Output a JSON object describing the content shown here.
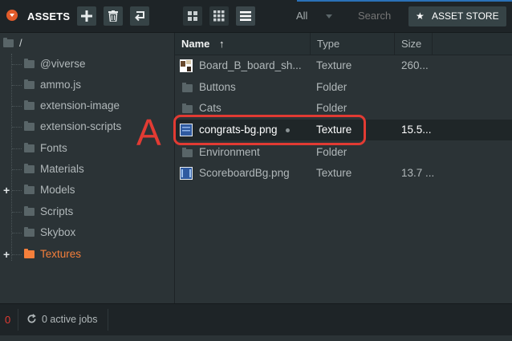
{
  "toolbar": {
    "title": "ASSETS",
    "add_label": "+",
    "filter_value": "All",
    "search_placeholder": "Search",
    "store_label": "ASSET STORE"
  },
  "tree": {
    "root_label": "/",
    "items": [
      {
        "label": "@viverse",
        "expandable": false,
        "active": false
      },
      {
        "label": "ammo.js",
        "expandable": false,
        "active": false
      },
      {
        "label": "extension-image",
        "expandable": false,
        "active": false
      },
      {
        "label": "extension-scripts",
        "expandable": false,
        "active": false
      },
      {
        "label": "Fonts",
        "expandable": false,
        "active": false
      },
      {
        "label": "Materials",
        "expandable": false,
        "active": false
      },
      {
        "label": "Models",
        "expandable": true,
        "active": false
      },
      {
        "label": "Scripts",
        "expandable": false,
        "active": false
      },
      {
        "label": "Skybox",
        "expandable": false,
        "active": false
      },
      {
        "label": "Textures",
        "expandable": true,
        "active": true
      }
    ],
    "expand_glyph": "+"
  },
  "table": {
    "headers": {
      "name": "Name",
      "sort_arrow": "↑",
      "type": "Type",
      "size": "Size"
    },
    "rows": [
      {
        "name": "Board_B_board_sh...",
        "type": "Texture",
        "size": "260...",
        "icon": "texture-thumbnail-icon"
      },
      {
        "name": "Buttons",
        "type": "Folder",
        "size": "",
        "icon": "folder-icon"
      },
      {
        "name": "Cats",
        "type": "Folder",
        "size": "",
        "icon": "folder-icon"
      },
      {
        "name": "congrats-bg.png",
        "type": "Texture",
        "size": "15.5...",
        "icon": "texture-thumbnail-icon",
        "selected": true
      },
      {
        "name": "Environment",
        "type": "Folder",
        "size": "",
        "icon": "folder-icon"
      },
      {
        "name": "ScoreboardBg.png",
        "type": "Texture",
        "size": "13.7 ...",
        "icon": "texture-thumbnail-icon"
      }
    ]
  },
  "annotation": {
    "letter": "A",
    "color": "#e23b33"
  },
  "status": {
    "error_count": "0",
    "jobs_label": "0 active jobs"
  },
  "colors": {
    "accent": "#f57f3b",
    "selected_row": "#1f2628",
    "panel": "#2b3336"
  }
}
